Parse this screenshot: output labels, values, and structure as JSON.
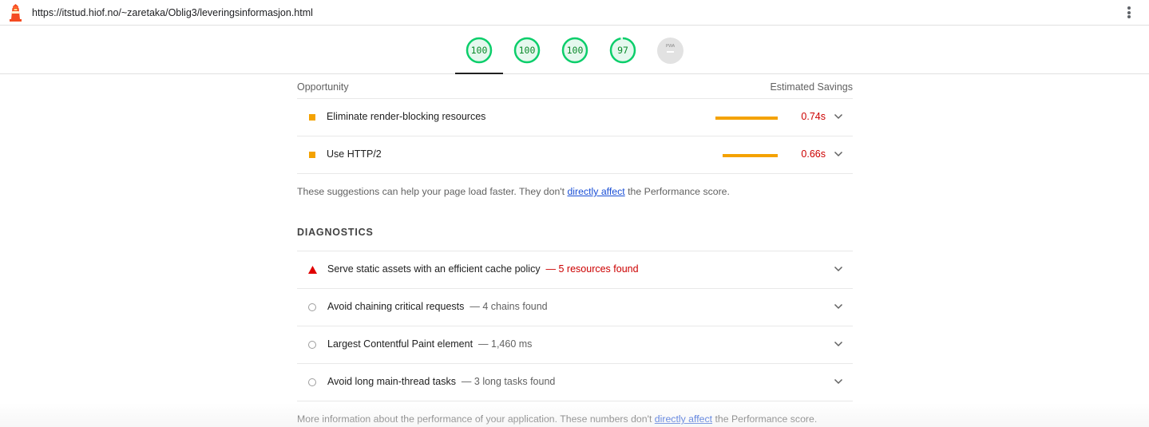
{
  "browser": {
    "url": "https://itstud.hiof.no/~zaretaka/Oblig3/leveringsinformasjon.html"
  },
  "scores": [
    {
      "value": "100",
      "fraction": 1.0,
      "color": "#0cce6b"
    },
    {
      "value": "100",
      "fraction": 1.0,
      "color": "#0cce6b"
    },
    {
      "value": "100",
      "fraction": 1.0,
      "color": "#0cce6b"
    },
    {
      "value": "97",
      "fraction": 0.97,
      "color": "#0cce6b"
    }
  ],
  "pwa": {
    "label": "PWA",
    "value": "—"
  },
  "opportunity": {
    "header_left": "Opportunity",
    "header_right": "Estimated Savings",
    "items": [
      {
        "title": "Eliminate render-blocking resources",
        "saving": "0.74s",
        "bar_fraction": 0.74
      },
      {
        "title": "Use HTTP/2",
        "saving": "0.66s",
        "bar_fraction": 0.66
      }
    ],
    "note_before": "These suggestions can help your page load faster. They don't ",
    "note_link": "directly affect",
    "note_after": " the Performance score."
  },
  "diagnostics": {
    "title": "DIAGNOSTICS",
    "items": [
      {
        "title": "Serve static assets with an efficient cache policy",
        "meta": "— 5 resources found",
        "status": "fail"
      },
      {
        "title": "Avoid chaining critical requests",
        "meta": "— 4 chains found",
        "status": "info"
      },
      {
        "title": "Largest Contentful Paint element",
        "meta": "— 1,460 ms",
        "status": "info"
      },
      {
        "title": "Avoid long main-thread tasks",
        "meta": "— 3 long tasks found",
        "status": "info"
      }
    ],
    "note_before": "More information about the performance of your application. These numbers don't ",
    "note_link": "directly affect",
    "note_after": " the Performance score."
  },
  "colors": {
    "accent_orange": "#f4a200",
    "fail_red": "#cc0000",
    "pass_green": "#0cce6b",
    "link_blue": "#1a4fd6"
  }
}
